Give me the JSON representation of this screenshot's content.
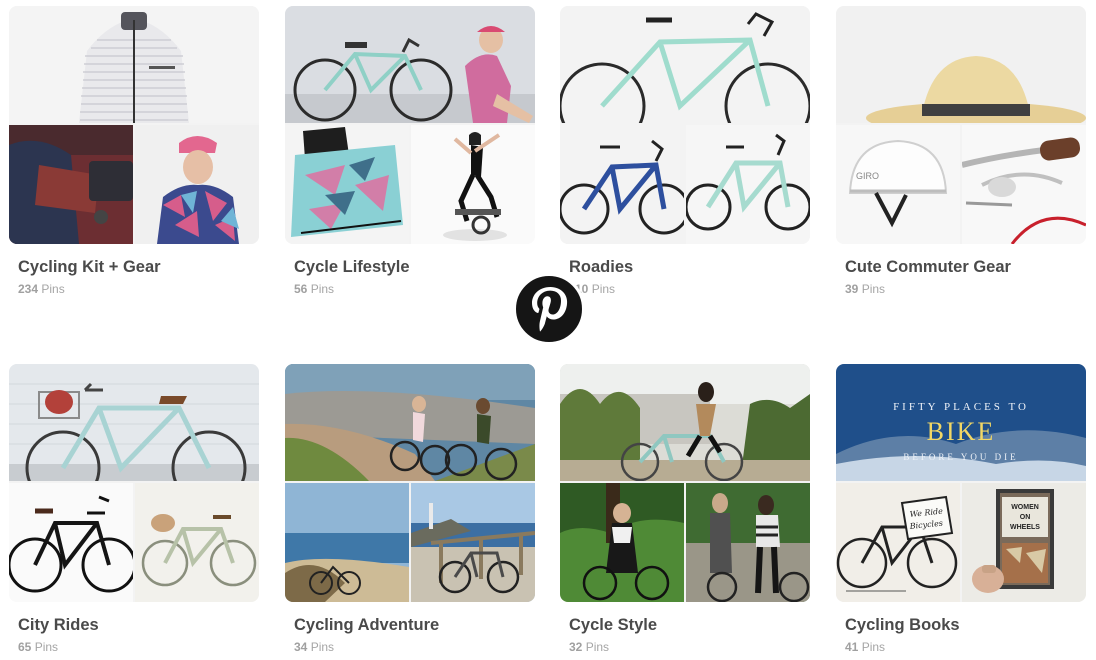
{
  "logo": {
    "name": "pinterest-logo-icon",
    "color": "#111111"
  },
  "boards": [
    {
      "title": "Cycling Kit + Gear",
      "count": "234",
      "pins_label": "Pins",
      "images": [
        "striped-cycling-jersey",
        "arm-warmers-and-bag",
        "woman-in-patterned-jersey-and-cap"
      ]
    },
    {
      "title": "Cycle Lifestyle",
      "count": "56",
      "pins_label": "Pins",
      "images": [
        "woman-sitting-with-road-bike",
        "folded-cycling-shorts",
        "woman-on-spin-bike"
      ]
    },
    {
      "title": "Roadies",
      "count": "110",
      "pins_label": "Pins",
      "images": [
        "mint-road-bike",
        "blue-road-bike",
        "mint-road-bike-side"
      ]
    },
    {
      "title": "Cute Commuter Gear",
      "count": "39",
      "pins_label": "Pins",
      "images": [
        "straw-hat",
        "white-bike-helmet",
        "brown-bike-grips"
      ]
    },
    {
      "title": "City Rides",
      "count": "65",
      "pins_label": "Pins",
      "images": [
        "mint-city-bike-with-basket",
        "black-city-bike",
        "sage-city-bike"
      ]
    },
    {
      "title": "Cycling Adventure",
      "count": "34",
      "pins_label": "Pins",
      "images": [
        "women-riding-coastal-path",
        "bike-by-the-ocean",
        "bike-at-seaside-railing"
      ]
    },
    {
      "title": "Cycle Style",
      "count": "32",
      "pins_label": "Pins",
      "images": [
        "woman-riding-past-cactus",
        "woman-in-dress-with-bike",
        "man-and-woman-with-bikes"
      ]
    },
    {
      "title": "Cycling Books",
      "count": "41",
      "pins_label": "Pins",
      "images": [
        "fifty-places-to-bike-book",
        "we-ride-bicycles-sketch",
        "women-on-wheels-book"
      ],
      "book_text": {
        "line1": "FIFTY PLACES TO",
        "line2": "BIKE",
        "line3": "BEFORE YOU DIE",
        "sign": "We Ride Bicycles",
        "book": "WOMEN ON WHEELS"
      }
    }
  ]
}
